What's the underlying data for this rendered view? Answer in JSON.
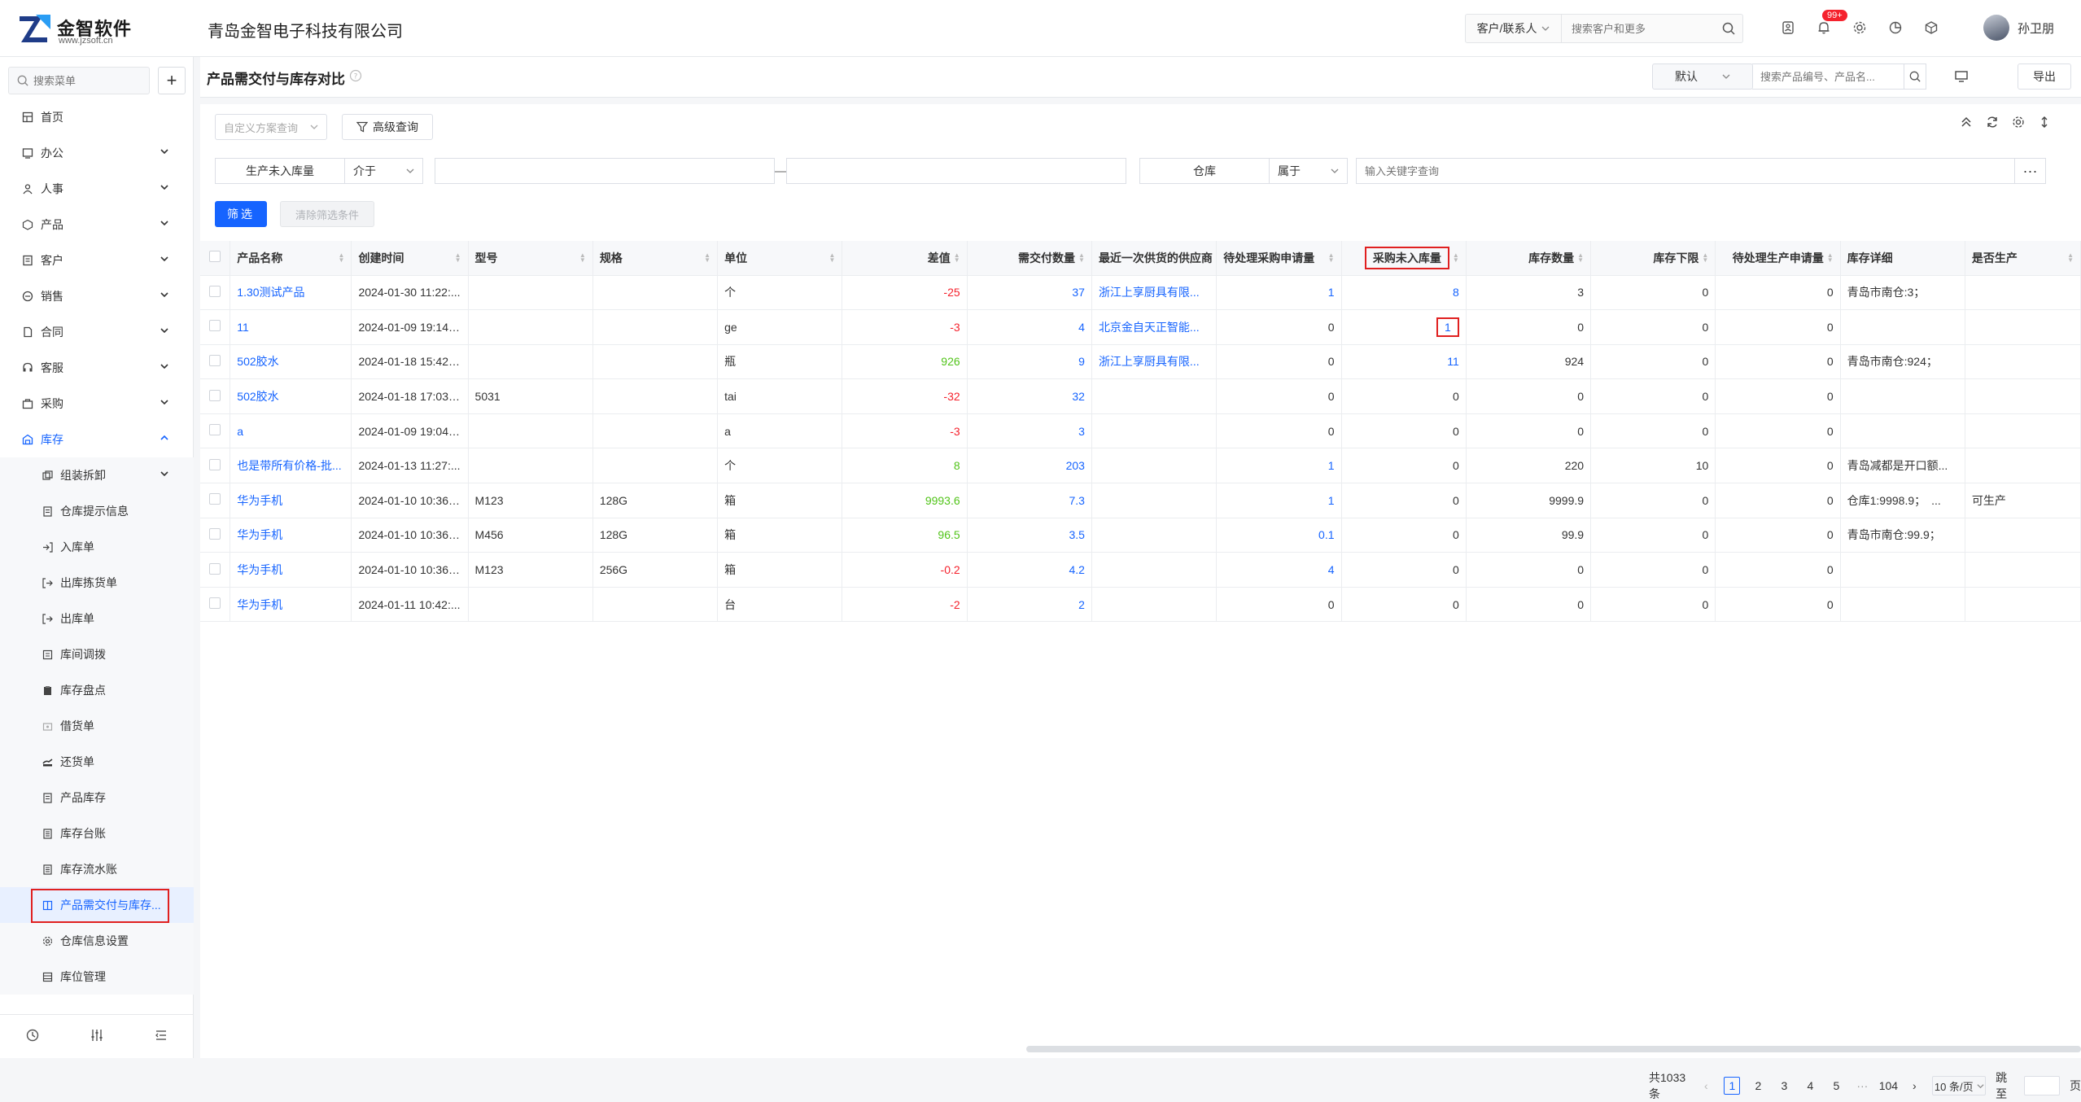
{
  "brand": {
    "name": "金智软件",
    "url": "www.jzsoft.cn"
  },
  "company": "青岛金智电子科技有限公司",
  "topbar": {
    "customer_select": "客户/联系人",
    "customer_placeholder": "搜索客户和更多",
    "notification_badge": "99+",
    "user_name": "孙卫朋"
  },
  "sidebar": {
    "search_placeholder": "搜索菜单",
    "menu": [
      {
        "label": "首页",
        "icon": "home-icon"
      },
      {
        "label": "办公",
        "icon": "office-icon"
      },
      {
        "label": "人事",
        "icon": "people-icon"
      },
      {
        "label": "产品",
        "icon": "cube-icon"
      },
      {
        "label": "客户",
        "icon": "customer-icon"
      },
      {
        "label": "销售",
        "icon": "sales-icon"
      },
      {
        "label": "合同",
        "icon": "contract-icon"
      },
      {
        "label": "客服",
        "icon": "service-icon"
      },
      {
        "label": "采购",
        "icon": "purchase-icon"
      },
      {
        "label": "库存",
        "icon": "warehouse-icon"
      }
    ],
    "inventory_sub": [
      "组装拆卸",
      "仓库提示信息",
      "入库单",
      "出库拣货单",
      "出库单",
      "库间调拨",
      "库存盘点",
      "借货单",
      "还货单",
      "产品库存",
      "库存台账",
      "库存流水账",
      "产品需交付与库存...",
      "仓库信息设置",
      "库位管理"
    ]
  },
  "page": {
    "title": "产品需交付与库存对比",
    "view_select": "默认",
    "product_search_placeholder": "搜索产品编号、产品名...",
    "export_label": "导出"
  },
  "filters": {
    "scheme_placeholder": "自定义方案查询",
    "advanced_label": "高级查询",
    "field1": "生产未入库量",
    "op1": "介于",
    "field2": "仓库",
    "op2": "属于",
    "keyword_placeholder": "输入关键字查询",
    "filter_btn": "筛选",
    "clear_btn": "清除筛选条件"
  },
  "table": {
    "headers": [
      "产品名称",
      "创建时间",
      "型号",
      "规格",
      "单位",
      "差值",
      "需交付数量",
      "最近一次供货的供应商",
      "待处理采购申请量",
      "采购未入库量",
      "库存数量",
      "库存下限",
      "待处理生产申请量",
      "库存详细",
      "是否生产"
    ],
    "rows": [
      [
        "1.30测试产品",
        "2024-01-30 11:22:...",
        "",
        "",
        "个",
        "-25",
        "37",
        "浙江上享厨具有限...",
        "1",
        "8",
        "3",
        "0",
        "0",
        "青岛市南仓:3；",
        ""
      ],
      [
        "11",
        "2024-01-09 19:14:...",
        "",
        "",
        "ge",
        "-3",
        "4",
        "北京金自天正智能...",
        "0",
        "1",
        "0",
        "0",
        "0",
        "",
        ""
      ],
      [
        "502胶水",
        "2024-01-18 15:42:...",
        "",
        "",
        "瓶",
        "926",
        "9",
        "浙江上享厨具有限...",
        "0",
        "11",
        "924",
        "0",
        "0",
        "青岛市南仓:924；",
        ""
      ],
      [
        "502胶水",
        "2024-01-18 17:03:...",
        "5031",
        "",
        "tai",
        "-32",
        "32",
        "",
        "0",
        "0",
        "0",
        "0",
        "0",
        "",
        ""
      ],
      [
        "a",
        "2024-01-09 19:04:...",
        "",
        "",
        "a",
        "-3",
        "3",
        "",
        "0",
        "0",
        "0",
        "0",
        "0",
        "",
        ""
      ],
      [
        "也是带所有价格-批...",
        "2024-01-13 11:27:...",
        "",
        "",
        "个",
        "8",
        "203",
        "",
        "1",
        "0",
        "220",
        "10",
        "0",
        "青岛减都是开口额...",
        ""
      ],
      [
        "华为手机",
        "2024-01-10 10:36:...",
        "M123",
        "128G",
        "箱",
        "9993.6",
        "7.3",
        "",
        "1",
        "0",
        "9999.9",
        "0",
        "0",
        "仓库1:9998.9；　...",
        "可生产"
      ],
      [
        "华为手机",
        "2024-01-10 10:36:...",
        "M456",
        "128G",
        "箱",
        "96.5",
        "3.5",
        "",
        "0.1",
        "0",
        "99.9",
        "0",
        "0",
        "青岛市南仓:99.9；",
        ""
      ],
      [
        "华为手机",
        "2024-01-10 10:36:...",
        "M123",
        "256G",
        "箱",
        "-0.2",
        "4.2",
        "",
        "4",
        "0",
        "0",
        "0",
        "0",
        "",
        ""
      ],
      [
        "华为手机",
        "2024-01-11 10:42:...",
        "",
        "",
        "台",
        "-2",
        "2",
        "",
        "0",
        "0",
        "0",
        "0",
        "0",
        "",
        ""
      ]
    ]
  },
  "pagination": {
    "total": "共1033条",
    "pages": [
      "1",
      "2",
      "3",
      "4",
      "5",
      "···",
      "104"
    ],
    "page_size": "10 条/页",
    "jump_label": "跳至",
    "page_suffix": "页"
  },
  "colors": {
    "primary": "#1664ff",
    "negative": "#f5222d",
    "positive": "#52c41a",
    "highlight": "#e02020"
  }
}
